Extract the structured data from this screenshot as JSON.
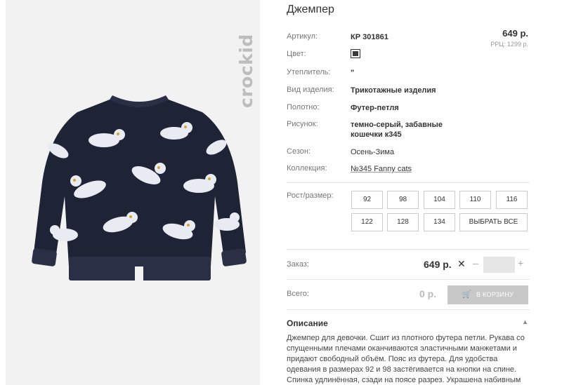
{
  "product": {
    "title": "Джемпер",
    "price": "649 р.",
    "rrp": "РРЦ: 1299 р."
  },
  "brand": "crockid",
  "colors": {
    "swatch": "#3a3a3a",
    "button_disabled": "#c8c8c8"
  },
  "attributes": [
    {
      "label": "Артикул:",
      "value": "КР 301861"
    },
    {
      "label": "Цвет:",
      "value": ""
    },
    {
      "label": "Утеплитель:",
      "value": "\""
    },
    {
      "label": "Вид изделия:",
      "value": "Трикотажные изделия"
    },
    {
      "label": "Полотно:",
      "value": "Футер-петля"
    },
    {
      "label": "Рисунок:",
      "value": "темно-серый, забавные\nкошечки к345"
    },
    {
      "label": "Сезон:",
      "value": "Осень-Зима"
    },
    {
      "label": "Коллекция:",
      "value": "№345 Fanny cats"
    }
  ],
  "sizes": {
    "label": "Рост/размер:",
    "options": [
      "92",
      "98",
      "104",
      "110",
      "116",
      "122",
      "128",
      "134"
    ],
    "select_all": "ВЫБРАТЬ ВСЕ"
  },
  "order": {
    "label": "Заказ:",
    "price": "649 р.",
    "remove": "✕",
    "minus": "–",
    "plus": "+",
    "quantity": ""
  },
  "total": {
    "label": "Всего:",
    "value": "0 р.",
    "cart_button": "В КОРЗИНУ"
  },
  "description": {
    "heading": "Описание",
    "text": "Джемпер для девочки. Сшит из плотного футера петли. Рукава со спущенными плечами оканчиваются эластичными манжетами и придают свободный объём. Пояс из футера. Для удобства одевания в размерах 92 и 98 застёгивается на кнопки на спине. Спинка удлинённая, сзади на поясе разрез. Украшена набивным рисунком с"
  }
}
